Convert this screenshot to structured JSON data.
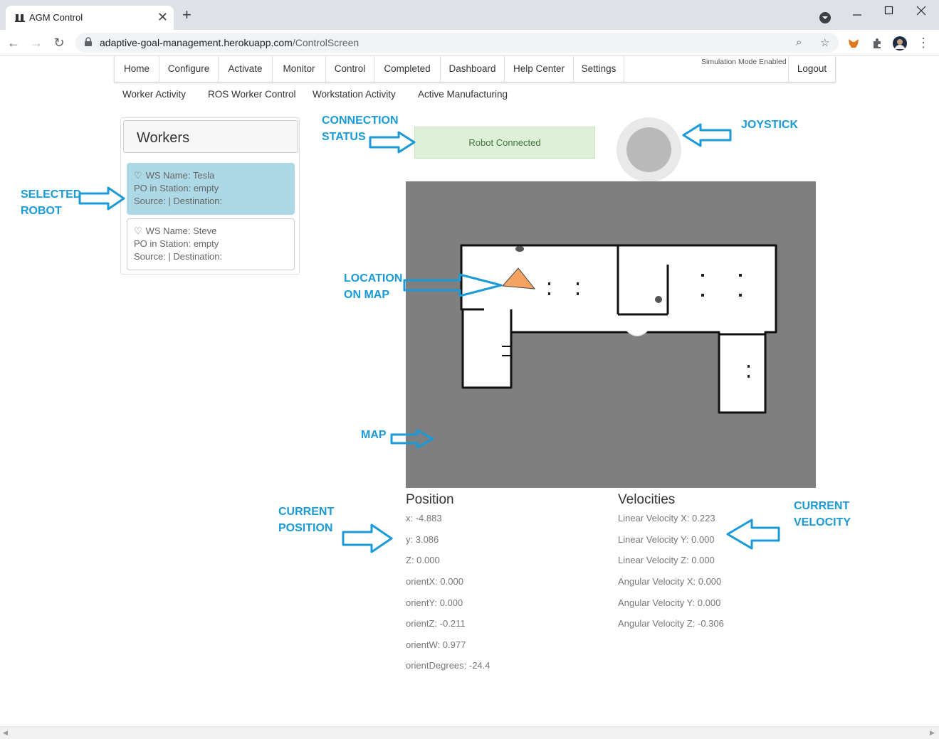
{
  "browser": {
    "tab_title": "AGM Control",
    "new_tab": "+",
    "close_tab": "✕",
    "url_host": "adaptive-goal-management.herokuapp.com",
    "url_path": "/ControlScreen"
  },
  "nav": {
    "items": [
      "Home",
      "Configure",
      "Activate",
      "Monitor",
      "Control",
      "Completed",
      "Dashboard",
      "Help Center",
      "Settings"
    ],
    "simulation_mode": "Simulation Mode Enabled",
    "logout": "Logout"
  },
  "subnav": [
    "Worker Activity",
    "ROS Worker Control",
    "Workstation Activity",
    "Active Manufacturing"
  ],
  "workers": {
    "title": "Workers",
    "items": [
      {
        "name": "WS Name: Tesla",
        "po": "PO in Station: empty",
        "route": "Source: | Destination:",
        "selected": true
      },
      {
        "name": "WS Name: Steve",
        "po": "PO in Station: empty",
        "route": "Source: | Destination:",
        "selected": false
      }
    ]
  },
  "connection": {
    "status": "Robot Connected"
  },
  "position": {
    "title": "Position",
    "lines": [
      "x: -4.883",
      "y: 3.086",
      "Z: 0.000",
      "orientX: 0.000",
      "orientY: 0.000",
      "orientZ: -0.211",
      "orientW: 0.977",
      "orientDegrees: -24.4"
    ]
  },
  "velocities": {
    "title": "Velocities",
    "lines": [
      "Linear Velocity X: 0.223",
      "Linear Velocity Y: 0.000",
      "Linear Velocity Z: 0.000",
      "Angular Velocity X: 0.000",
      "Angular Velocity Y: 0.000",
      "Angular Velocity Z: -0.306"
    ]
  },
  "annotations": {
    "connection_1": "CONNECTION",
    "connection_2": "STATUS",
    "joystick": "JOYSTICK",
    "selected_1": "SELECTED",
    "selected_2": "ROBOT",
    "location_1": "LOCATION",
    "location_2": "ON MAP",
    "map": "MAP",
    "position_1": "CURRENT",
    "position_2": "POSITION",
    "velocity_1": "CURRENT",
    "velocity_2": "VELOCITY"
  },
  "colors": {
    "annotation": "#1a9bd7",
    "selected_card": "#add8e6",
    "status_bg": "#dff0d8",
    "robot_marker": "#f4a460",
    "map_unknown": "#7f7f7f"
  }
}
